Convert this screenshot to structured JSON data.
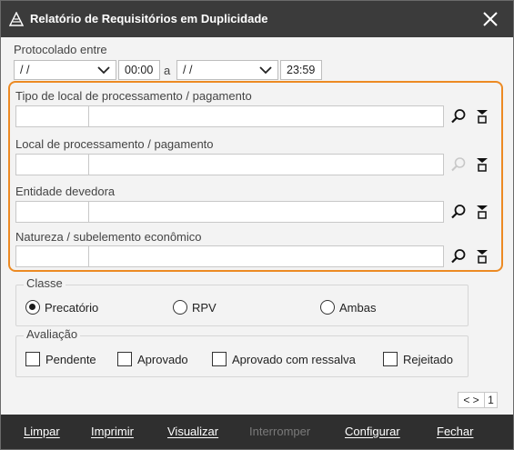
{
  "window": {
    "title": "Relatório de Requisitórios em Duplicidade"
  },
  "protocolado": {
    "label": "Protocolado entre",
    "date_from": "/ /",
    "time_from": "00:00",
    "separator": "a",
    "date_to": "/ /",
    "time_to": "23:59"
  },
  "fields": [
    {
      "label": "Tipo de local de processamento / pagamento",
      "code": "",
      "description": "",
      "search_enabled": true
    },
    {
      "label": "Local de processamento / pagamento",
      "code": "",
      "description": "",
      "search_enabled": false
    },
    {
      "label": "Entidade devedora",
      "code": "",
      "description": "",
      "search_enabled": true
    },
    {
      "label": "Natureza / subelemento econômico",
      "code": "",
      "description": "",
      "search_enabled": true
    }
  ],
  "classe": {
    "title": "Classe",
    "options": [
      "Precatório",
      "RPV",
      "Ambas"
    ],
    "selected": "Precatório"
  },
  "avaliacao": {
    "title": "Avaliação",
    "options": [
      "Pendente",
      "Aprovado",
      "Aprovado com ressalva",
      "Rejeitado"
    ]
  },
  "pager": {
    "arrows": "< >",
    "page": "1"
  },
  "footer": {
    "limpar": "Limpar",
    "imprimir": "Imprimir",
    "visualizar": "Visualizar",
    "interromper": "Interromper",
    "configurar": "Configurar",
    "fechar": "Fechar"
  },
  "colors": {
    "highlight": "#ec8a23",
    "titlebar": "#3b3b3b",
    "footer": "#2f2f2f"
  }
}
